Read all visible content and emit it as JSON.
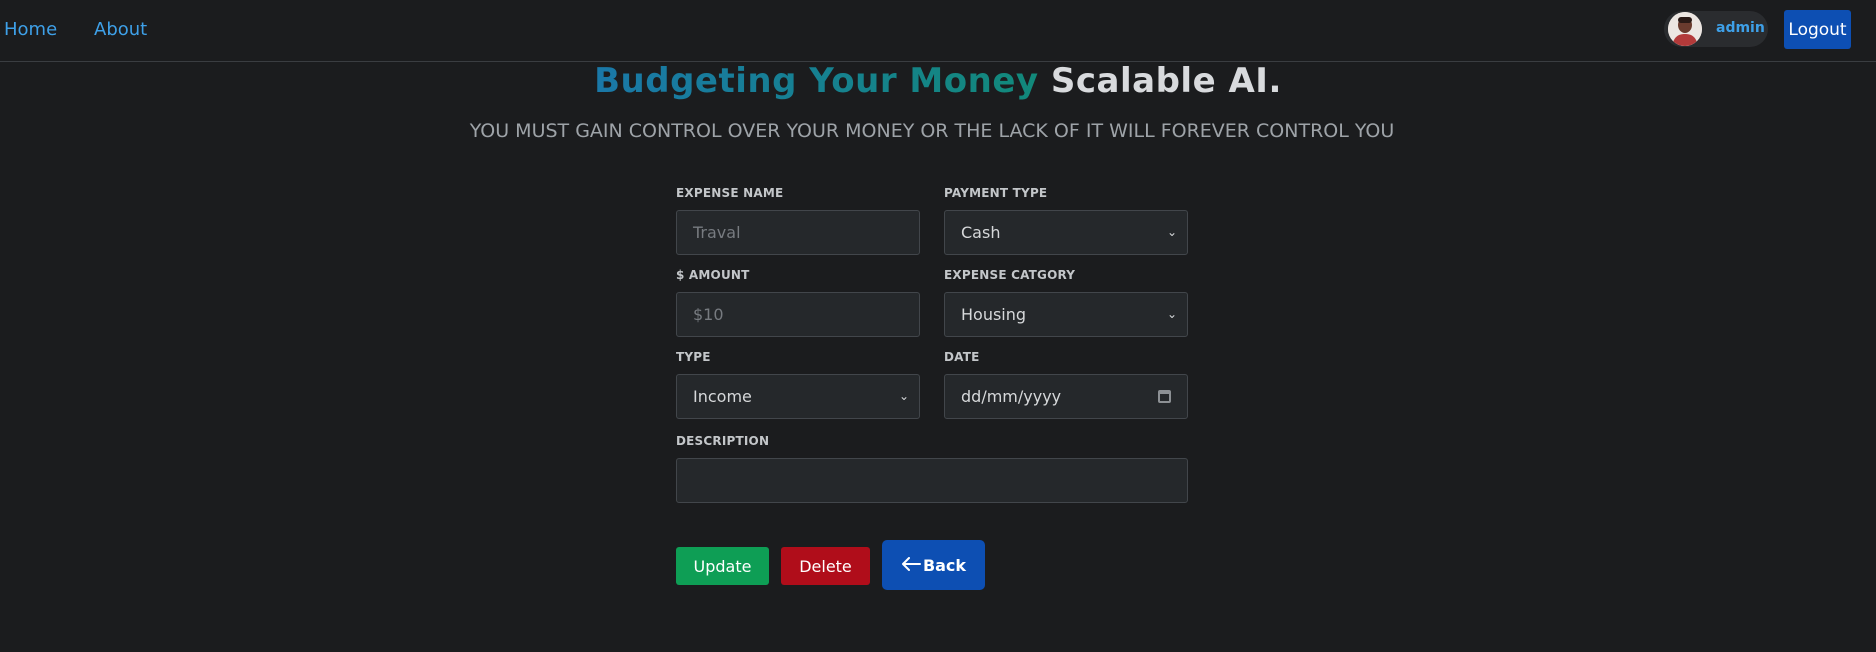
{
  "nav": {
    "home": "Home",
    "about": "About",
    "user_name": "admin",
    "logout": "Logout"
  },
  "header": {
    "title_highlight": "Budgeting Your Money",
    "title_rest": "Scalable AI.",
    "subtitle": "YOU MUST GAIN CONTROL OVER YOUR MONEY OR THE LACK OF IT WILL FOREVER CONTROL YOU"
  },
  "form": {
    "expense_name": {
      "label": "EXPENSE NAME",
      "placeholder": "Traval",
      "value": ""
    },
    "payment_type": {
      "label": "PAYMENT TYPE",
      "value": "Cash"
    },
    "amount": {
      "label": "$ AMOUNT",
      "placeholder": "$10",
      "value": ""
    },
    "expense_category": {
      "label": "EXPENSE CATGORY",
      "value": "Housing"
    },
    "type": {
      "label": "TYPE",
      "value": "Income"
    },
    "date": {
      "label": "DATE",
      "placeholder": "dd/mm/yyyy"
    },
    "description": {
      "label": "DESCRIPTION",
      "value": ""
    }
  },
  "actions": {
    "update": "Update",
    "delete": "Delete",
    "back": "Back"
  },
  "colors": {
    "background": "#1b1c1e",
    "link": "#3ea0e8",
    "primary": "#0d4fb3",
    "success": "#0e9e55",
    "danger": "#b00d1a"
  },
  "icons": {
    "back": "arrow-left-icon",
    "select": "chevron-down-icon",
    "date": "calendar-icon"
  }
}
